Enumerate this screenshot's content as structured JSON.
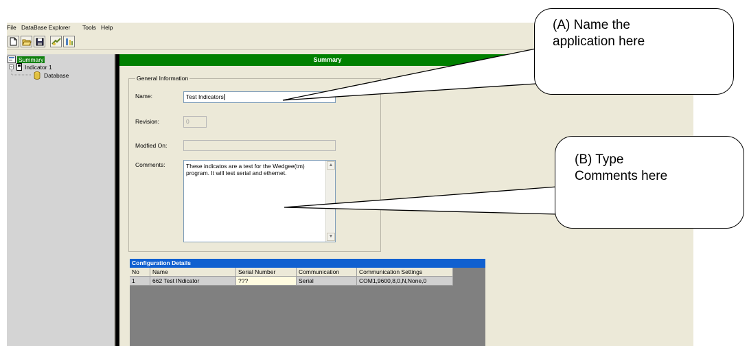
{
  "menu": [
    "File",
    "DataBase Explorer",
    "Tools",
    "Help"
  ],
  "toolbar": {
    "buttons": [
      {
        "icon": "new-document-icon"
      },
      {
        "icon": "open-folder-icon"
      },
      {
        "icon": "save-disk-icon"
      },
      {
        "icon": "connect-icon"
      },
      {
        "icon": "settings-properties-icon"
      }
    ]
  },
  "tree": {
    "summary": "Summary",
    "indicator": "Indicator 1",
    "database": "Database",
    "expand_glyph": "−"
  },
  "summary_bar": "Summary",
  "general_info": {
    "title": "General Information",
    "name_label": "Name:",
    "name_value": "Test Indicators",
    "revision_label": "Revision:",
    "revision_value": "0",
    "modified_label": "Modfied On:",
    "modified_value": "",
    "comments_label": "Comments:",
    "comments_value": "These indicatos are  a test for the Wedgee(tm) program. It will test serial and ethernet."
  },
  "config": {
    "title": "Configuration Details",
    "columns": [
      "No",
      "Name",
      "Serial Number",
      "Communication",
      "Communication Settings"
    ],
    "rows": [
      [
        "1",
        "662 Test INdicator",
        "???",
        "Serial",
        "COM1,9600,8,0,N,None,0"
      ]
    ]
  },
  "callouts": {
    "a_line1": "(A) Name the",
    "a_line2": "application here",
    "b_line1": "(B) Type",
    "b_line2": "Comments here"
  },
  "colors": {
    "summary_green": "#008000",
    "config_blue": "#1060d0",
    "window_bg": "#ece9d8"
  }
}
